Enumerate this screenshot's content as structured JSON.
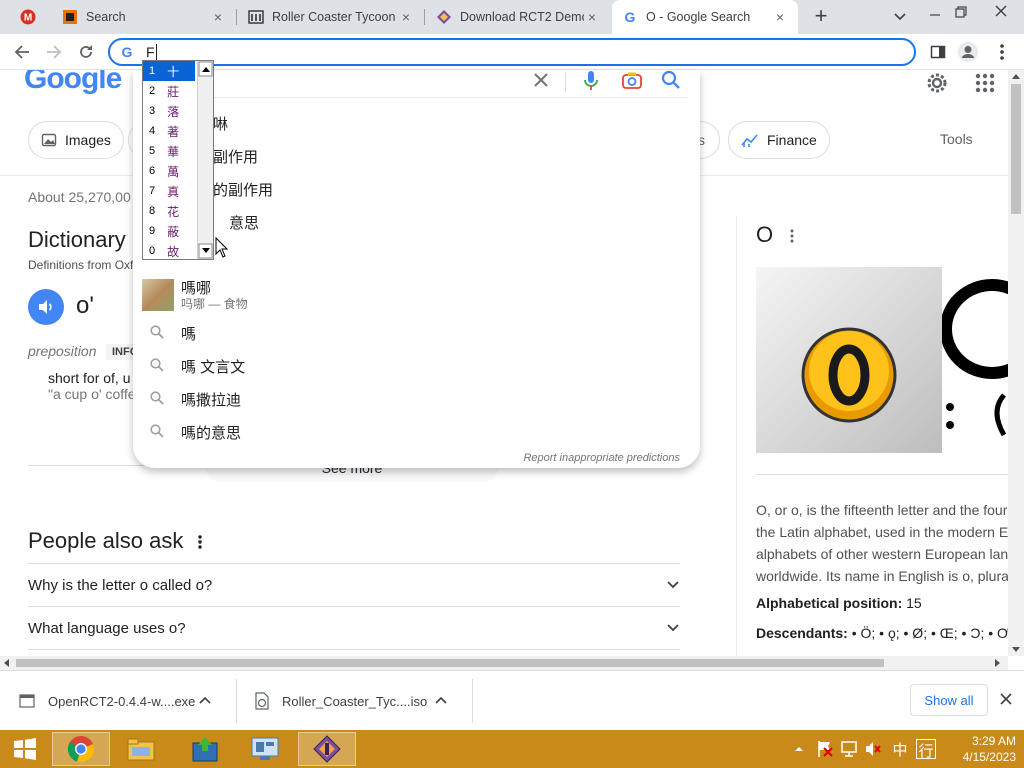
{
  "tabs": [
    {
      "title": "Search",
      "close": "×"
    },
    {
      "title": "Roller Coaster Tycoon (",
      "close": "×"
    },
    {
      "title": "Download RCT2 Demo",
      "close": "×"
    },
    {
      "title": "O - Google Search",
      "close": "×"
    }
  ],
  "new_tab": "+",
  "omnibox": {
    "value": "F"
  },
  "ime": {
    "candidates": [
      {
        "n": "1",
        "ch": "十"
      },
      {
        "n": "2",
        "ch": "莊"
      },
      {
        "n": "3",
        "ch": "落"
      },
      {
        "n": "4",
        "ch": "著"
      },
      {
        "n": "5",
        "ch": "華"
      },
      {
        "n": "6",
        "ch": "萬"
      },
      {
        "n": "7",
        "ch": "真"
      },
      {
        "n": "8",
        "ch": "花"
      },
      {
        "n": "9",
        "ch": "蔽"
      },
      {
        "n": "0",
        "ch": "故"
      }
    ]
  },
  "google": {
    "logo": "Google",
    "chips": [
      "Images",
      "s",
      "Finance"
    ],
    "tools": "Tools",
    "result_count": "About 25,270,00",
    "dictionary": {
      "title": "Dictionary",
      "source": "Definitions from Oxf",
      "word": "o'",
      "pos": "preposition",
      "pos_badge": "INFO",
      "definition": "short for of, u",
      "example": "\"a cup o' coffe",
      "see_more": "See more"
    },
    "paa": {
      "title": "People also ask",
      "questions": [
        "Why is the letter o called o?",
        "What language uses o?"
      ]
    },
    "knowledge": {
      "title": "O",
      "description_lines": [
        "O, or o, is the fifteenth letter and the four",
        "the Latin alphabet, used in the modern En",
        "alphabets of other western European lan",
        "worldwide. Its name in English is o, plura"
      ],
      "position_label": "Alphabetical position:",
      "position_value": "15",
      "descendants_label": "Descendants:",
      "descendants_value": "• Ö; • ǫ; • Ø; • Œ; • Ɔ; • Ơ; • ("
    }
  },
  "suggestions": {
    "partial": [
      "啉",
      "副作用",
      "的副作用",
      "意思"
    ],
    "entity": {
      "title": "嗎哪",
      "subtitle": "吗哪 — 食物"
    },
    "items": [
      "嗎",
      "嗎 文言文",
      "嗎撒拉迪",
      "嗎的意思"
    ],
    "report": "Report inappropriate predictions"
  },
  "downloads": {
    "files": [
      "OpenRCT2-0.4.4-w....exe",
      "Roller_Coaster_Tyc....iso"
    ],
    "show_all": "Show all"
  },
  "taskbar": {
    "time": "3:29 AM",
    "date": "4/15/2023",
    "ime_glyph": "中",
    "ime_mode": "行"
  }
}
